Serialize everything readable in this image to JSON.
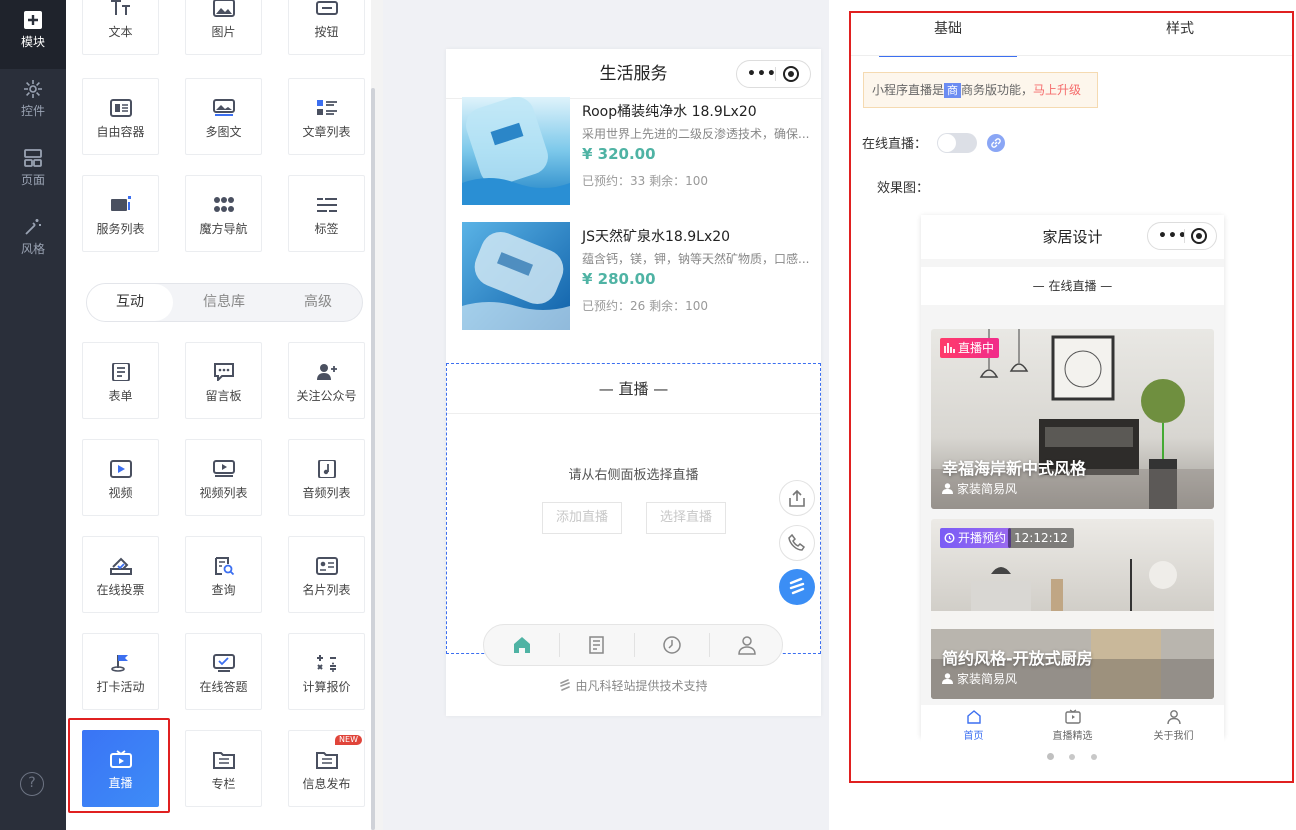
{
  "rail": {
    "items": [
      {
        "label": "模块",
        "icon": "plus-square-icon"
      },
      {
        "label": "控件",
        "icon": "sliders-icon"
      },
      {
        "label": "页面",
        "icon": "layout-icon"
      },
      {
        "label": "风格",
        "icon": "magic-wand-icon"
      }
    ],
    "help": "?"
  },
  "palette": {
    "top_tiles": [
      "文本",
      "图片",
      "按钮",
      "自由容器",
      "多图文",
      "文章列表",
      "服务列表",
      "魔方导航",
      "标签"
    ],
    "segments": [
      "互动",
      "信息库",
      "高级"
    ],
    "tiles": [
      "表单",
      "留言板",
      "关注公众号",
      "视频",
      "视频列表",
      "音频列表",
      "在线投票",
      "查询",
      "名片列表",
      "打卡活动",
      "在线答题",
      "计算报价",
      "直播",
      "专栏",
      "信息发布"
    ],
    "new_badge": "NEW"
  },
  "phone": {
    "title": "生活服务",
    "capsule_dots": "•••",
    "products": [
      {
        "name": "Roop桶装纯净水 18.9Lx20",
        "desc": "采用世界上先进的二级反渗透技术，确保...",
        "price": "¥ 320.00",
        "stock": "已预约：33  剩余：100"
      },
      {
        "name": "JS天然矿泉水18.9Lx20",
        "desc": "蕴含钙，镁，钾，钠等天然矿物质，口感...",
        "price": "¥ 280.00",
        "stock": "已预约：26  剩余：100"
      }
    ],
    "live_section_title": "—  直播  —",
    "live_hint": "请从右侧面板选择直播",
    "add_live": "添加直播",
    "choose_live": "选择直播",
    "footer": "由凡科轻站提供技术支持"
  },
  "panel": {
    "tabs": [
      "基础",
      "样式"
    ],
    "notice_prefix": "小程序直播是",
    "notice_tag": "商",
    "notice_mid": "商务版功能，",
    "notice_upgrade": "马上升级",
    "live_toggle_label": "在线直播：",
    "effect_label": "效果图：",
    "mini": {
      "title": "家居设计",
      "section": "—  在线直播  —",
      "cards": [
        {
          "badge": "直播中",
          "title": "幸福海岸新中式风格",
          "author": "家装简易风"
        },
        {
          "badge": "开播预约",
          "time": "12:12:12",
          "title": "简约风格-开放式厨房",
          "author": "家装简易风"
        }
      ],
      "tabs": [
        "首页",
        "直播精选",
        "关于我们"
      ]
    }
  },
  "colors": {
    "accent": "#3c6ff0",
    "highlight_border": "#e02020",
    "price": "#4fb3a4"
  }
}
